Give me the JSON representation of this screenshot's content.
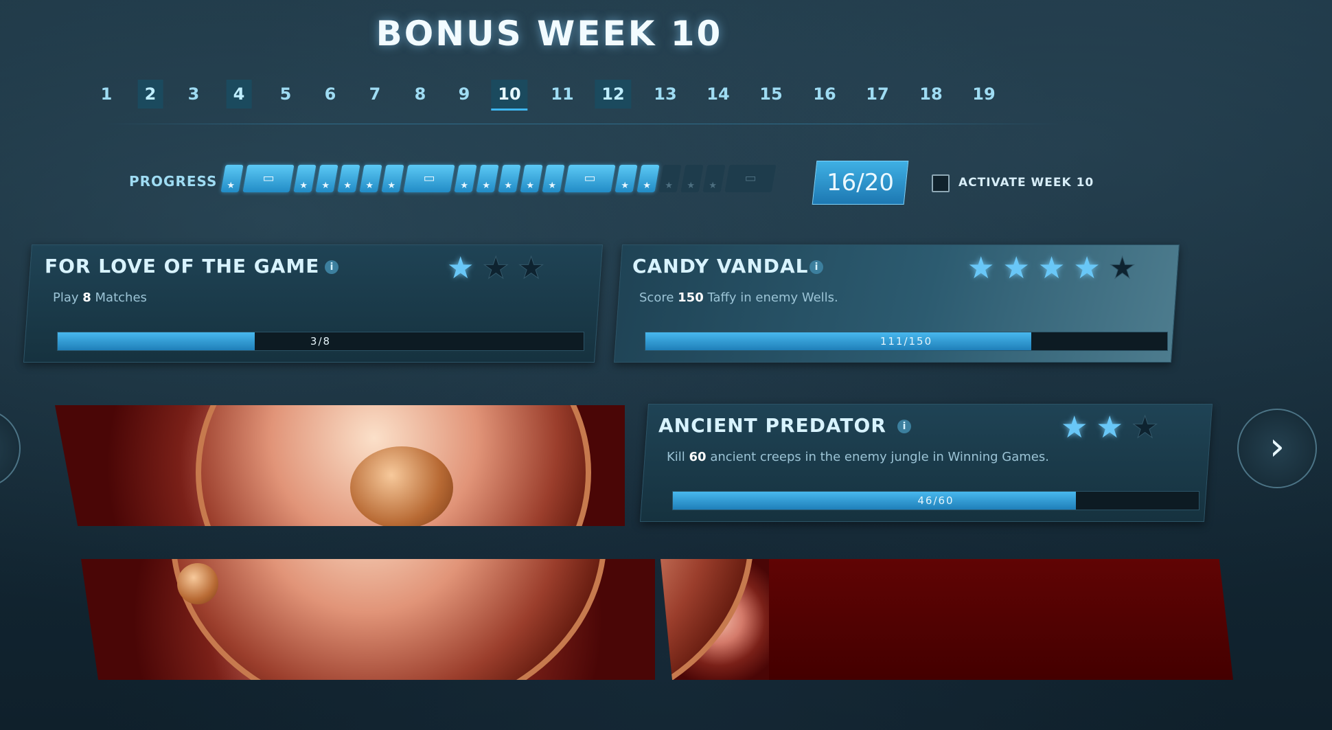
{
  "title": "BONUS WEEK  10",
  "weeks": [
    {
      "label": "1",
      "state": "normal"
    },
    {
      "label": "2",
      "state": "owned"
    },
    {
      "label": "3",
      "state": "normal"
    },
    {
      "label": "4",
      "state": "owned"
    },
    {
      "label": "5",
      "state": "normal"
    },
    {
      "label": "6",
      "state": "normal"
    },
    {
      "label": "7",
      "state": "normal"
    },
    {
      "label": "8",
      "state": "normal"
    },
    {
      "label": "9",
      "state": "normal"
    },
    {
      "label": "10",
      "state": "active"
    },
    {
      "label": "11",
      "state": "normal"
    },
    {
      "label": "12",
      "state": "owned"
    },
    {
      "label": "13",
      "state": "normal"
    },
    {
      "label": "14",
      "state": "normal"
    },
    {
      "label": "15",
      "state": "normal"
    },
    {
      "label": "16",
      "state": "normal"
    },
    {
      "label": "17",
      "state": "normal"
    },
    {
      "label": "18",
      "state": "normal"
    },
    {
      "label": "19",
      "state": "normal"
    }
  ],
  "progress": {
    "label": "PROGRESS",
    "count_text": "16/20",
    "earned": 16,
    "total": 20,
    "segments": [
      "star",
      "chest",
      "star",
      "star",
      "star",
      "star",
      "star",
      "chest",
      "star",
      "star",
      "star",
      "star",
      "star",
      "chest",
      "star",
      "star",
      "star",
      "star",
      "star",
      "chest"
    ]
  },
  "activate": {
    "label": "ACTIVATE WEEK 10",
    "checked": false
  },
  "quests": [
    {
      "title": "FOR LOVE OF THE GAME",
      "desc_pre": "Play ",
      "desc_num": "8",
      "desc_post": " Matches",
      "progress_text": "3/8",
      "current": 3,
      "target": 8,
      "stars_earned": 1,
      "stars_total": 3
    },
    {
      "title": "CANDY VANDAL",
      "desc_pre": "Score ",
      "desc_num": "150",
      "desc_post": " Taffy in enemy Wells.",
      "progress_text": "111/150",
      "current": 111,
      "target": 150,
      "stars_earned": 4,
      "stars_total": 5
    },
    {
      "title": "ANCIENT PREDATOR",
      "desc_pre": "Kill ",
      "desc_num": "60",
      "desc_post": " ancient creeps in the enemy jungle in Winning Games.",
      "progress_text": "46/60",
      "current": 46,
      "target": 60,
      "stars_earned": 2,
      "stars_total": 3
    }
  ],
  "icons": {
    "info": "info-icon",
    "star": "star-icon",
    "chest": "chest-icon",
    "next": "chevron-right-icon",
    "prev": "chevron-left-icon"
  },
  "glyphs": {
    "info": "i",
    "next": "›"
  },
  "colors": {
    "accent": "#48b8ee",
    "star_on": "#69c7f7",
    "art_red": "#7a2018"
  }
}
